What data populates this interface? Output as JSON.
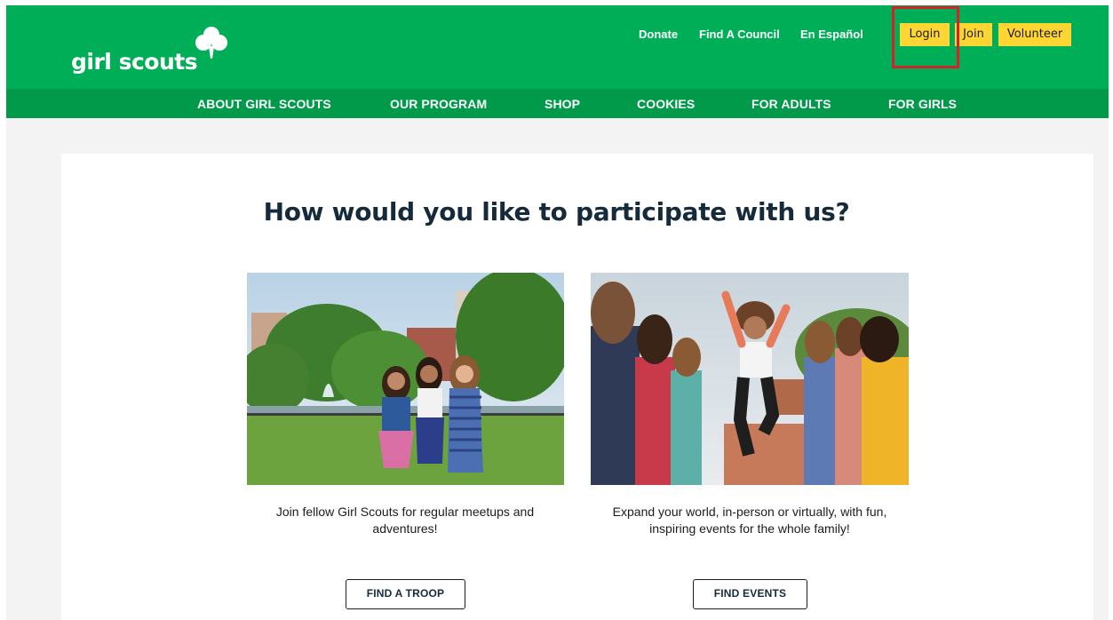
{
  "header": {
    "logo_text": "girl scouts",
    "utility_links": [
      "Donate",
      "Find A Council",
      "En Español"
    ],
    "buttons": {
      "login": "Login",
      "join": "Join",
      "volunteer": "Volunteer"
    }
  },
  "nav": {
    "items": [
      "ABOUT GIRL SCOUTS",
      "OUR PROGRAM",
      "SHOP",
      "COOKIES",
      "FOR ADULTS",
      "FOR GIRLS"
    ]
  },
  "main": {
    "headline": "How would you like to participate with us?",
    "options": [
      {
        "description": "Join fellow Girl Scouts for regular meetups and adventures!",
        "button": "FIND A TROOP"
      },
      {
        "description": "Expand your world, in-person or virtually, with fun, inspiring events for the whole family!",
        "button": "FIND EVENTS"
      }
    ]
  },
  "colors": {
    "header_green": "#00ae58",
    "nav_green": "#009a4a",
    "button_yellow": "#fed533",
    "highlight_red": "#d5222a",
    "heading_navy": "#152b3b"
  }
}
